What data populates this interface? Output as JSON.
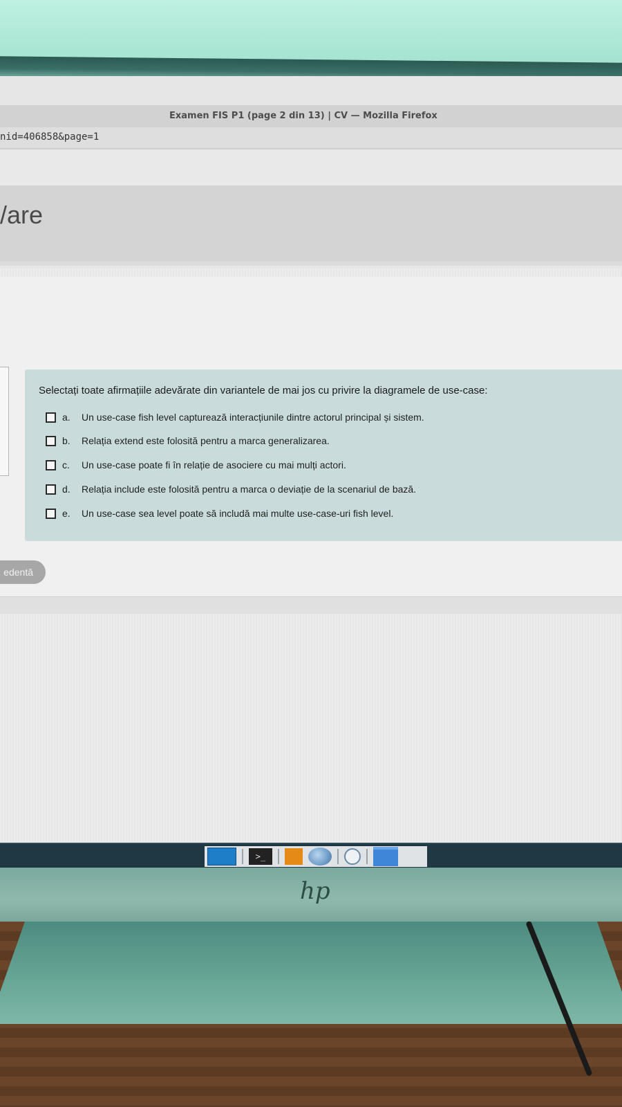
{
  "window": {
    "title": "Examen FIS P1 (page 2 din 13) | CV — Mozilla Firefox",
    "url_fragment": "nid=406858&page=1"
  },
  "page": {
    "heading_fragment": "/are"
  },
  "question": {
    "prompt": "Selectați toate afirmațiile adevărate din variantele de mai jos cu privire la diagramele de use-case:",
    "answers": [
      {
        "letter": "a.",
        "text": "Un use-case fish level capturează interacțiunile dintre actorul principal și sistem."
      },
      {
        "letter": "b.",
        "text": "Relația extend este folosită pentru a marca generalizarea."
      },
      {
        "letter": "c.",
        "text": "Un use-case poate fi în relație de asociere cu mai mulți actori."
      },
      {
        "letter": "d.",
        "text": "Relația include este folosită pentru a marca o deviație de la scenariul de bază."
      },
      {
        "letter": "e.",
        "text": "Un use-case sea level poate să includă mai multe use-case-uri fish level."
      }
    ]
  },
  "navigation": {
    "prev_label": "edentă"
  },
  "taskbar": {
    "icons": [
      "window-icon",
      "terminal-icon",
      "notes-icon",
      "browser-globe-icon",
      "disc-icon",
      "folder-icon"
    ],
    "terminal_glyph": ">_"
  },
  "brand": {
    "logo_text": "hp"
  },
  "colors": {
    "question_bg": "#c9dcdb",
    "taskbar_bg": "#1f3843",
    "monitor_bezel": "#7aa99e"
  }
}
